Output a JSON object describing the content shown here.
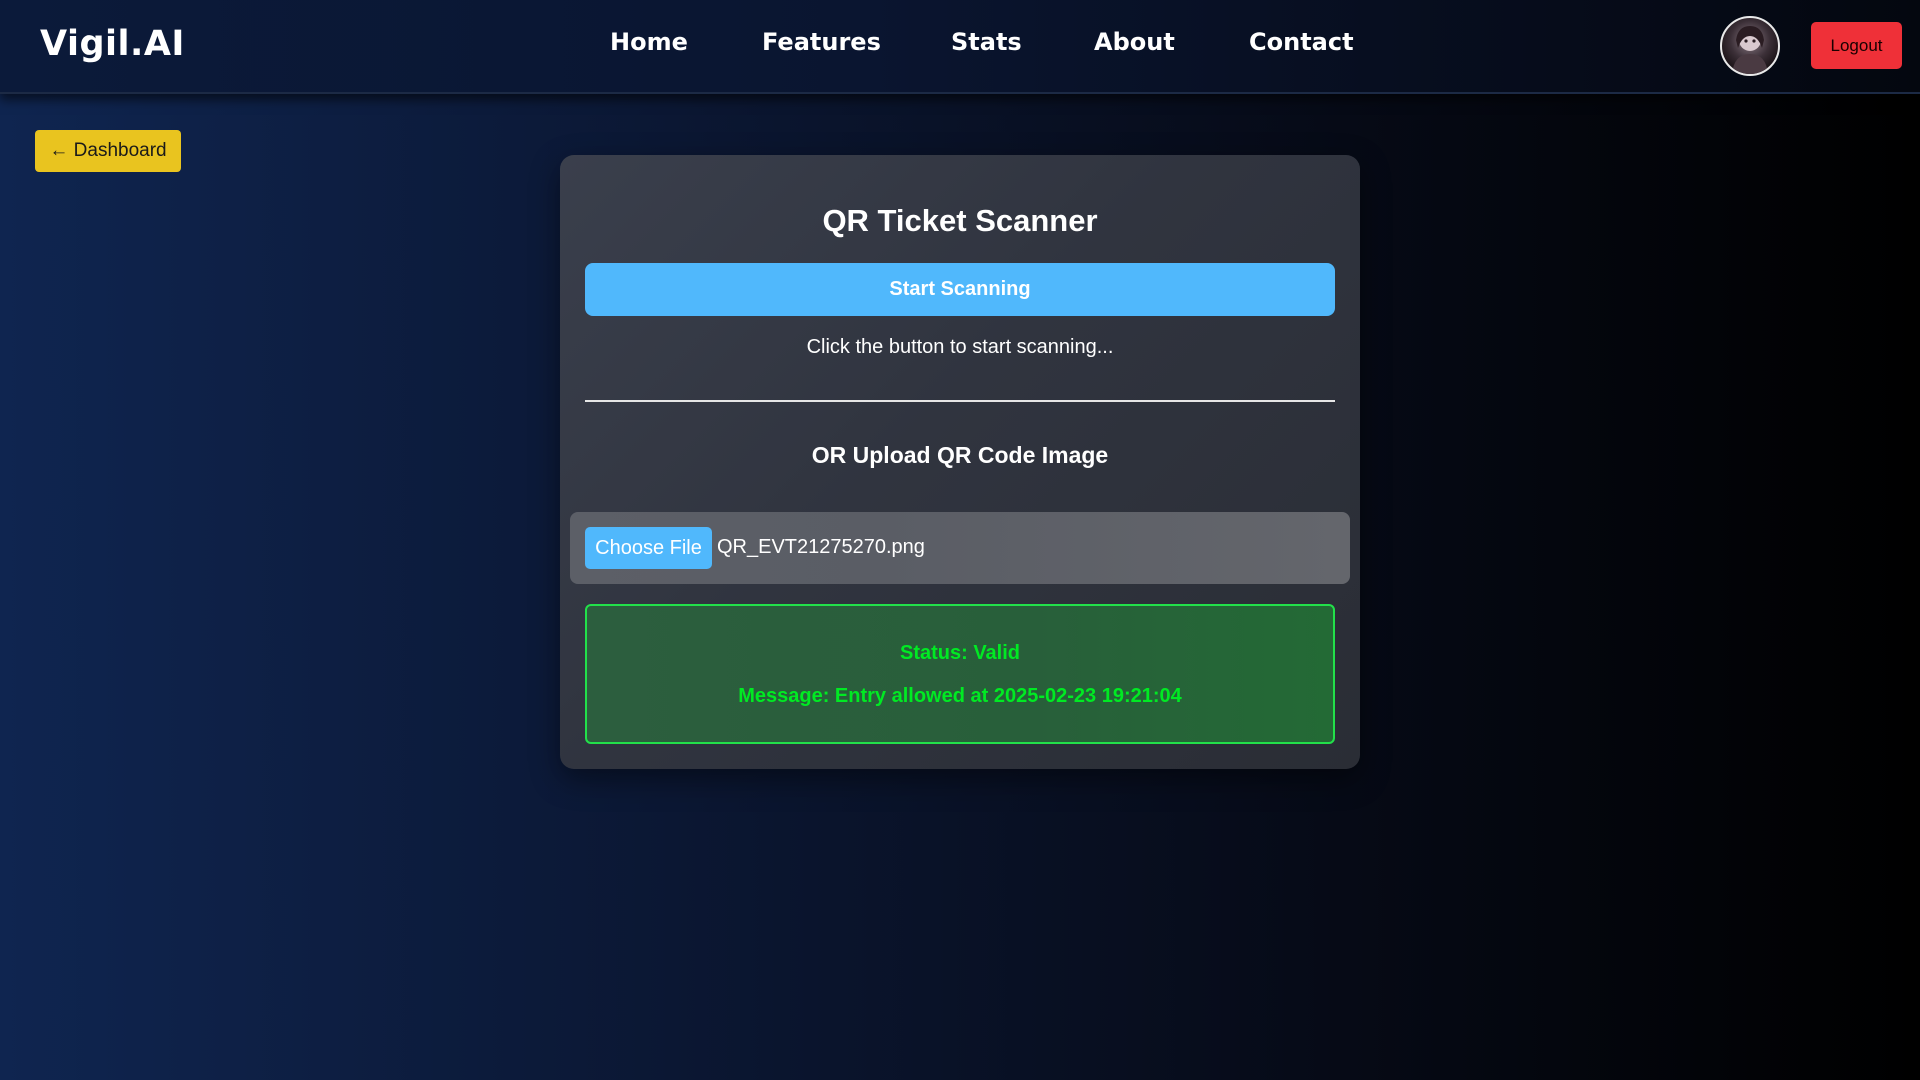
{
  "navbar": {
    "brand": "Vigil.AI",
    "links": [
      "Home",
      "Features",
      "Stats",
      "About",
      "Contact"
    ],
    "avatar_icon": "user-avatar-icon",
    "logout_label": "Logout",
    "logout_color": "#ef3038"
  },
  "back_button": {
    "label": "← Dashboard",
    "color": "#e9c41f"
  },
  "scanner": {
    "title": "QR Ticket Scanner",
    "start_button_label": "Start Scanning",
    "hint": "Click the button to start scanning...",
    "upload_heading": "OR Upload QR Code Image",
    "choose_file_label": "Choose File",
    "selected_file": "QR_EVT21275270.png",
    "accent_color": "#50b8fc"
  },
  "result": {
    "status": "Status: Valid",
    "message": "Message: Entry allowed at 2025-02-23 19:21:04",
    "color": "#00ea23"
  }
}
